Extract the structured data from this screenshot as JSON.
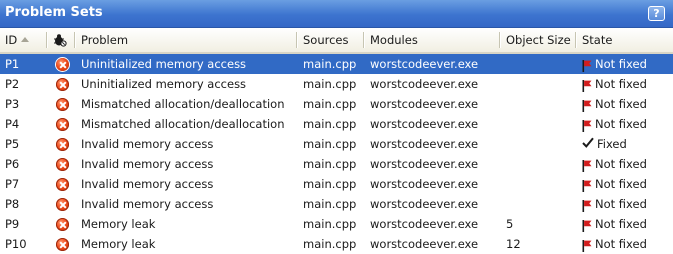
{
  "panel": {
    "title": "Problem Sets",
    "help_label": "?"
  },
  "columns": {
    "id": "ID",
    "icon": "bug-icon",
    "problem": "Problem",
    "sources": "Sources",
    "modules": "Modules",
    "object_size": "Object Size",
    "state": "State"
  },
  "sort": {
    "column": "ID",
    "direction": "ascending"
  },
  "colors": {
    "selection": "#316ac5",
    "title_bar": "#3d74cf",
    "error_icon": "#e0471a",
    "not_fixed_flag": "#d21d1d"
  },
  "rows": [
    {
      "id": "P1",
      "status_icon": "error-icon",
      "problem": "Uninitialized memory access",
      "sources": "main.cpp",
      "modules": "worstcodeever.exe",
      "object_size": "",
      "state": "Not fixed",
      "state_icon": "flag-icon",
      "selected": true
    },
    {
      "id": "P2",
      "status_icon": "error-icon",
      "problem": "Uninitialized memory access",
      "sources": "main.cpp",
      "modules": "worstcodeever.exe",
      "object_size": "",
      "state": "Not fixed",
      "state_icon": "flag-icon",
      "selected": false
    },
    {
      "id": "P3",
      "status_icon": "error-icon",
      "problem": "Mismatched allocation/deallocation",
      "sources": "main.cpp",
      "modules": "worstcodeever.exe",
      "object_size": "",
      "state": "Not fixed",
      "state_icon": "flag-icon",
      "selected": false
    },
    {
      "id": "P4",
      "status_icon": "error-icon",
      "problem": "Mismatched allocation/deallocation",
      "sources": "main.cpp",
      "modules": "worstcodeever.exe",
      "object_size": "",
      "state": "Not fixed",
      "state_icon": "flag-icon",
      "selected": false
    },
    {
      "id": "P5",
      "status_icon": "error-icon",
      "problem": "Invalid memory access",
      "sources": "main.cpp",
      "modules": "worstcodeever.exe",
      "object_size": "",
      "state": "Fixed",
      "state_icon": "checkmark-icon",
      "selected": false
    },
    {
      "id": "P6",
      "status_icon": "error-icon",
      "problem": "Invalid memory access",
      "sources": "main.cpp",
      "modules": "worstcodeever.exe",
      "object_size": "",
      "state": "Not fixed",
      "state_icon": "flag-icon",
      "selected": false
    },
    {
      "id": "P7",
      "status_icon": "error-icon",
      "problem": "Invalid memory access",
      "sources": "main.cpp",
      "modules": "worstcodeever.exe",
      "object_size": "",
      "state": "Not fixed",
      "state_icon": "flag-icon",
      "selected": false
    },
    {
      "id": "P8",
      "status_icon": "error-icon",
      "problem": "Invalid memory access",
      "sources": "main.cpp",
      "modules": "worstcodeever.exe",
      "object_size": "",
      "state": "Not fixed",
      "state_icon": "flag-icon",
      "selected": false
    },
    {
      "id": "P9",
      "status_icon": "error-icon",
      "problem": "Memory leak",
      "sources": "main.cpp",
      "modules": "worstcodeever.exe",
      "object_size": "5",
      "state": "Not fixed",
      "state_icon": "flag-icon",
      "selected": false
    },
    {
      "id": "P10",
      "status_icon": "error-icon",
      "problem": "Memory leak",
      "sources": "main.cpp",
      "modules": "worstcodeever.exe",
      "object_size": "12",
      "state": "Not fixed",
      "state_icon": "flag-icon",
      "selected": false
    }
  ]
}
